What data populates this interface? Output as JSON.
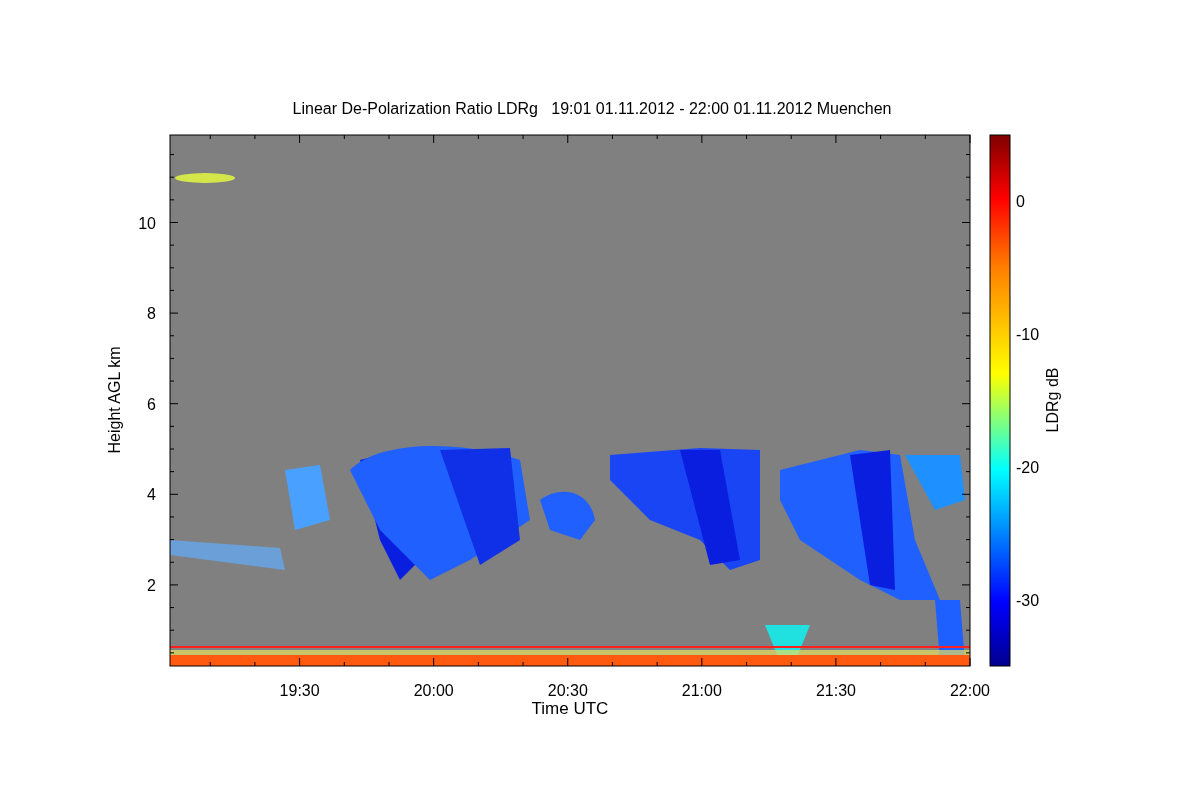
{
  "chart": {
    "title": "Linear De-Polarization Ratio LDRg   19:01 01.11.2012 - 22:00 01.11.2012 Muenchen",
    "xlabel": "Time UTC",
    "ylabel": "Height AGL km",
    "xticks": [
      "19:30",
      "20:00",
      "20:30",
      "21:00",
      "21:30",
      "22:00"
    ],
    "yticks": [
      "10",
      "8",
      "6",
      "4",
      "2"
    ]
  },
  "colorbar": {
    "label": "LDRg dB",
    "ticks": [
      "0",
      "-10",
      "-20",
      "-30"
    ]
  }
}
